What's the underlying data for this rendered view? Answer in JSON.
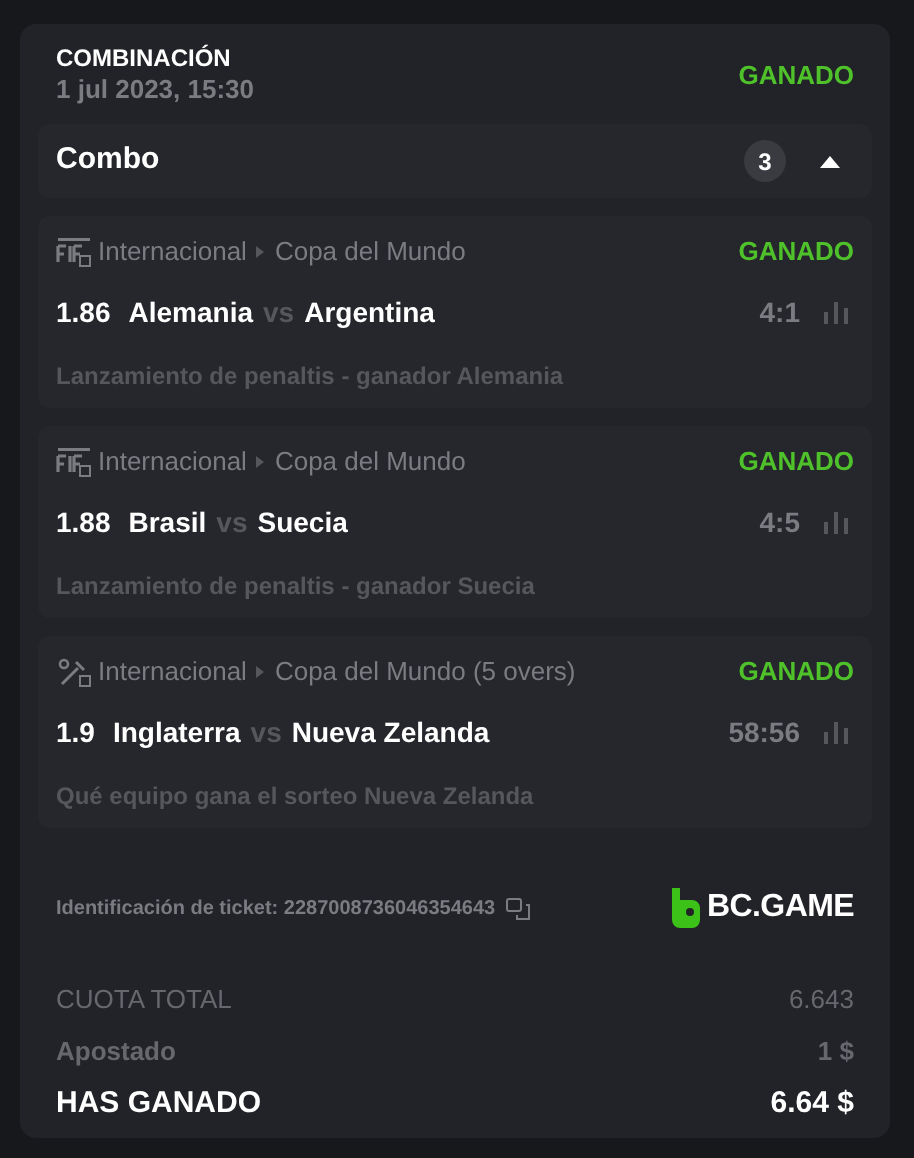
{
  "header": {
    "title": "COMBINACIÓN",
    "date": "1 jul 2023, 15:30",
    "status": "GANADO"
  },
  "combo": {
    "label": "Combo",
    "count": "3",
    "expanded": true
  },
  "bets": [
    {
      "kind": "fifa",
      "category": "Internacional",
      "league": "Copa del Mundo",
      "status": "GANADO",
      "odds": "1.86",
      "home": "Alemania",
      "vs": "vs",
      "away": "Argentina",
      "score": "4:1",
      "market": "Lanzamiento de penaltis - ganador Alemania"
    },
    {
      "kind": "fifa",
      "category": "Internacional",
      "league": "Copa del Mundo",
      "status": "GANADO",
      "odds": "1.88",
      "home": "Brasil",
      "vs": "vs",
      "away": "Suecia",
      "score": "4:5",
      "market": "Lanzamiento de penaltis - ganador Suecia"
    },
    {
      "kind": "cricket",
      "category": "Internacional",
      "league": "Copa del Mundo (5 overs)",
      "status": "GANADO",
      "odds": "1.9",
      "home": "Inglaterra",
      "vs": "vs",
      "away": "Nueva Zelanda",
      "score": "58:56",
      "market": "Qué equipo gana el sorteo Nueva Zelanda"
    }
  ],
  "ticket": {
    "label": "Identificación de ticket: 2287008736046354643",
    "brand": "BC.GAME"
  },
  "totals": [
    {
      "kind": "muted",
      "label": "CUOTA TOTAL",
      "value": "6.643"
    },
    {
      "kind": "bold",
      "label": "Apostado",
      "value": "1 $"
    },
    {
      "kind": "total",
      "label": "HAS GANADO",
      "value": "6.64 $"
    }
  ]
}
